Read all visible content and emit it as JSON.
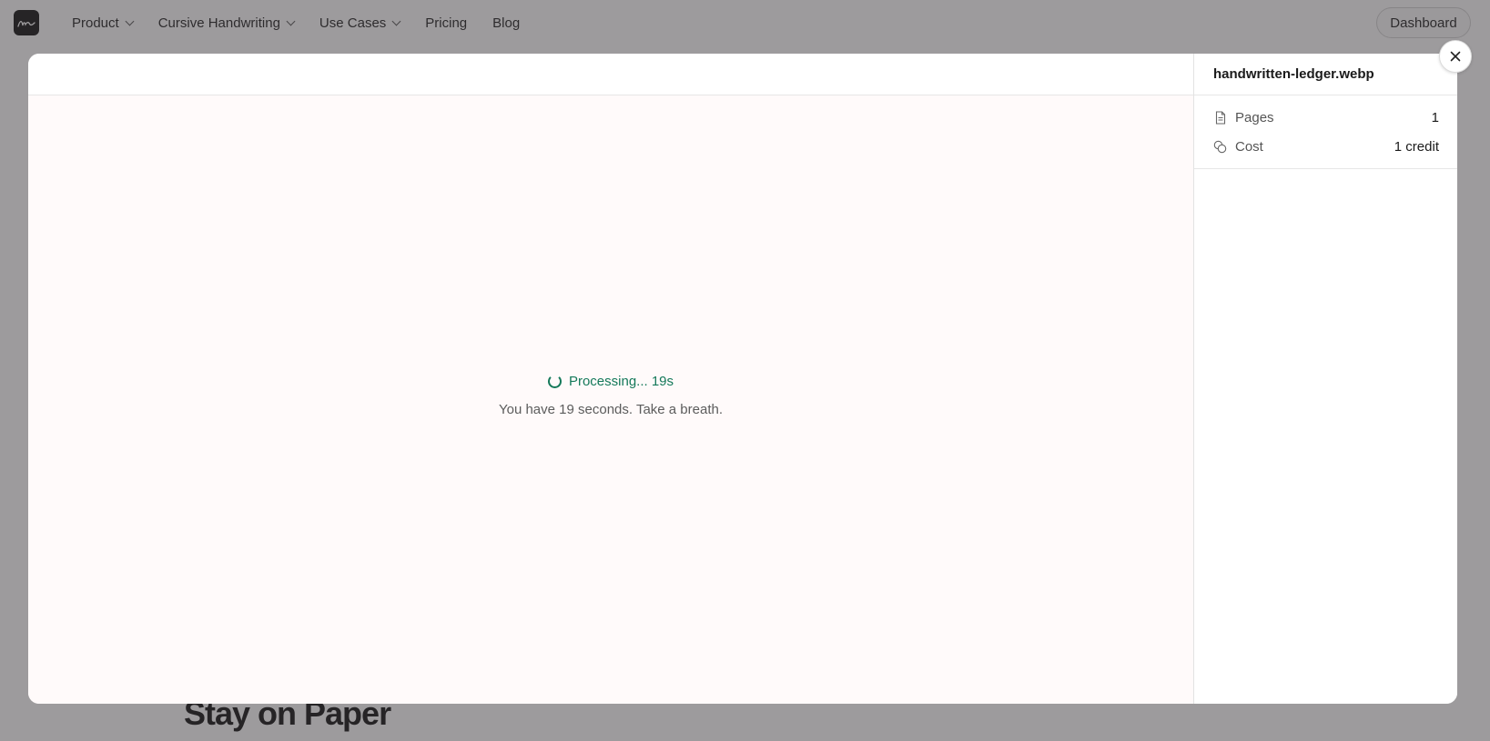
{
  "nav": {
    "logo_icon": "signature-logo-icon",
    "items": [
      {
        "label": "Product",
        "has_dropdown": true
      },
      {
        "label": "Cursive Handwriting",
        "has_dropdown": true
      },
      {
        "label": "Use Cases",
        "has_dropdown": true
      },
      {
        "label": "Pricing",
        "has_dropdown": false
      },
      {
        "label": "Blog",
        "has_dropdown": false
      }
    ],
    "dashboard_label": "Dashboard"
  },
  "background": {
    "heading": "Stay on Paper"
  },
  "modal": {
    "status": {
      "processing_label": "Processing... 19s",
      "subtext": "You have 19 seconds. Take a breath.",
      "color": "#15795a"
    },
    "side": {
      "filename": "handwritten-ledger.webp",
      "meta": [
        {
          "icon": "document-icon",
          "label": "Pages",
          "value": "1"
        },
        {
          "icon": "coins-icon",
          "label": "Cost",
          "value": "1 credit"
        }
      ]
    },
    "close_icon": "close-icon"
  }
}
